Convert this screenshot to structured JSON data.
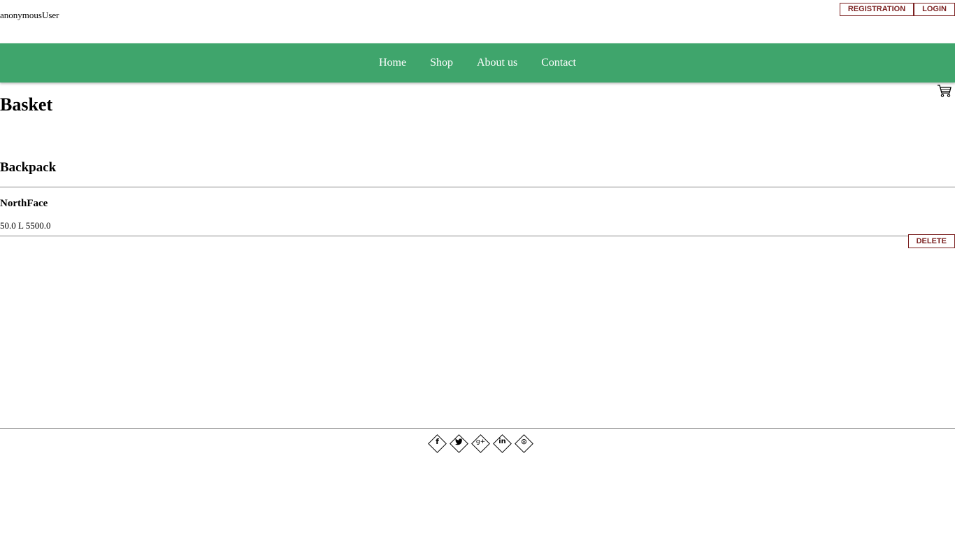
{
  "header": {
    "username": "anonymousUser",
    "registration_label": "REGISTRATION",
    "login_label": "LOGIN"
  },
  "nav": {
    "items": [
      {
        "label": "Home"
      },
      {
        "label": "Shop"
      },
      {
        "label": "About us"
      },
      {
        "label": "Contact"
      }
    ]
  },
  "main": {
    "title": "Basket",
    "cart_icon": "shopping-cart-icon",
    "items": [
      {
        "category": "Backpack",
        "brand": "NorthFace",
        "details": "50.0 L 5500.0",
        "delete_label": "DELETE"
      }
    ]
  },
  "footer": {
    "social": [
      {
        "icon": "facebook-icon",
        "glyph": "f"
      },
      {
        "icon": "twitter-icon",
        "glyph": "🐦"
      },
      {
        "icon": "google-plus-icon",
        "glyph": "g+"
      },
      {
        "icon": "linkedin-icon",
        "glyph": "in"
      },
      {
        "icon": "dribbble-icon",
        "glyph": "⊛"
      }
    ]
  },
  "colors": {
    "nav_background": "#3fa56c",
    "button_accent": "#7a1f1f"
  }
}
